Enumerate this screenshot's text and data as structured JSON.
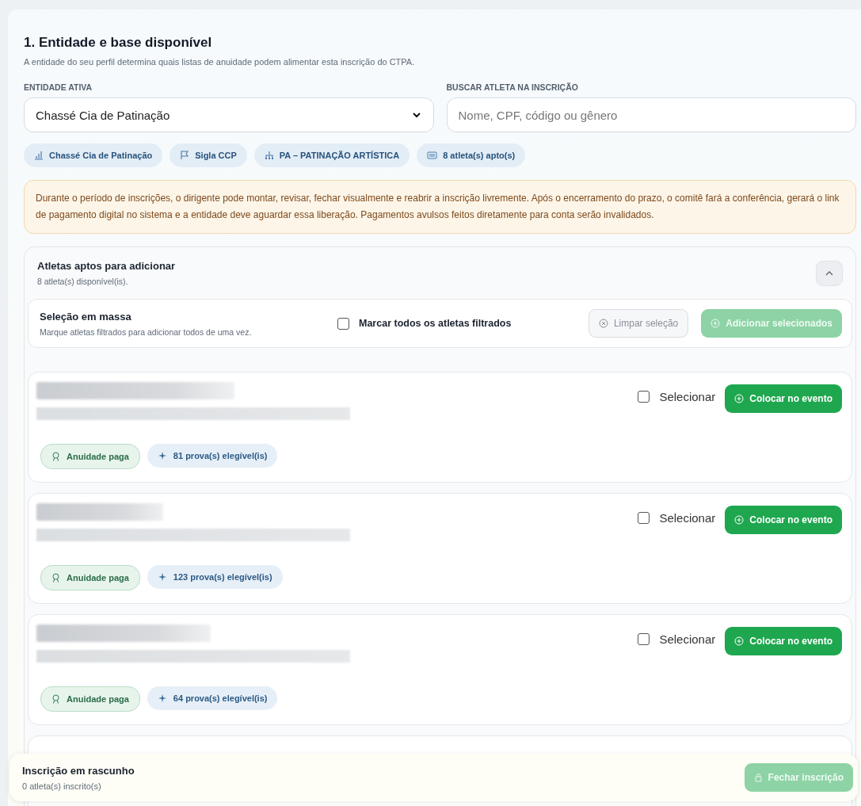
{
  "section": {
    "title": "1. Entidade e base disponível",
    "subtitle": "A entidade do seu perfil determina quais listas de anuidade podem alimentar esta inscrição do CTPA."
  },
  "entity_field": {
    "label": "ENTIDADE ATIVA",
    "value": "Chassé Cia de Patinação"
  },
  "search_field": {
    "label": "BUSCAR ATLETA NA INSCRIÇÃO",
    "placeholder": "Nome, CPF, código ou gênero"
  },
  "chips": [
    {
      "kind": "building",
      "label": "Chassé Cia de Patinação"
    },
    {
      "kind": "flag",
      "label": "Sigla CCP"
    },
    {
      "kind": "hierarchy",
      "label": "PA – PATINAÇÃO ARTÍSTICA"
    },
    {
      "kind": "list",
      "label": "8 atleta(s) apto(s)"
    }
  ],
  "notice": "Durante o período de inscrições, o dirigente pode montar, revisar, fechar visualmente e reabrir a inscrição livremente. Após o encerramento do prazo, o comitê fará a conferência, gerará o link de pagamento digital no sistema e a entidade deve aguardar essa liberação. Pagamentos avulsos feitos diretamente para conta serão invalidados.",
  "athletes_panel": {
    "title": "Atletas aptos para adicionar",
    "count": "8 atleta(s) disponível(is).",
    "expanded": true
  },
  "bulk": {
    "title": "Seleção em massa",
    "hint": "Marque atletas filtrados para adicionar todos de uma vez.",
    "select_all": {
      "label": "Marcar todos os atletas filtrados",
      "checked": false
    },
    "clear_button": {
      "label": "Limpar seleção",
      "disabled": true
    },
    "add_button": {
      "label": "Adicionar selecionados",
      "disabled": true
    }
  },
  "athletes": [
    {
      "select_label": "Selecionar",
      "selected": false,
      "action": "Colocar no evento",
      "status": "Anuidade paga",
      "events": "81 prova(s) elegível(is)"
    },
    {
      "select_label": "Selecionar",
      "selected": false,
      "action": "Colocar no evento",
      "status": "Anuidade paga",
      "events": "123 prova(s) elegível(is)"
    },
    {
      "select_label": "Selecionar",
      "selected": false,
      "action": "Colocar no evento",
      "status": "Anuidade paga",
      "events": "64 prova(s) elegível(is)"
    }
  ],
  "footer": {
    "title": "Inscrição em rascunho",
    "count": "0 atleta(s) inscrito(s)",
    "button": {
      "label": "Fechar inscrição",
      "disabled": true
    }
  }
}
